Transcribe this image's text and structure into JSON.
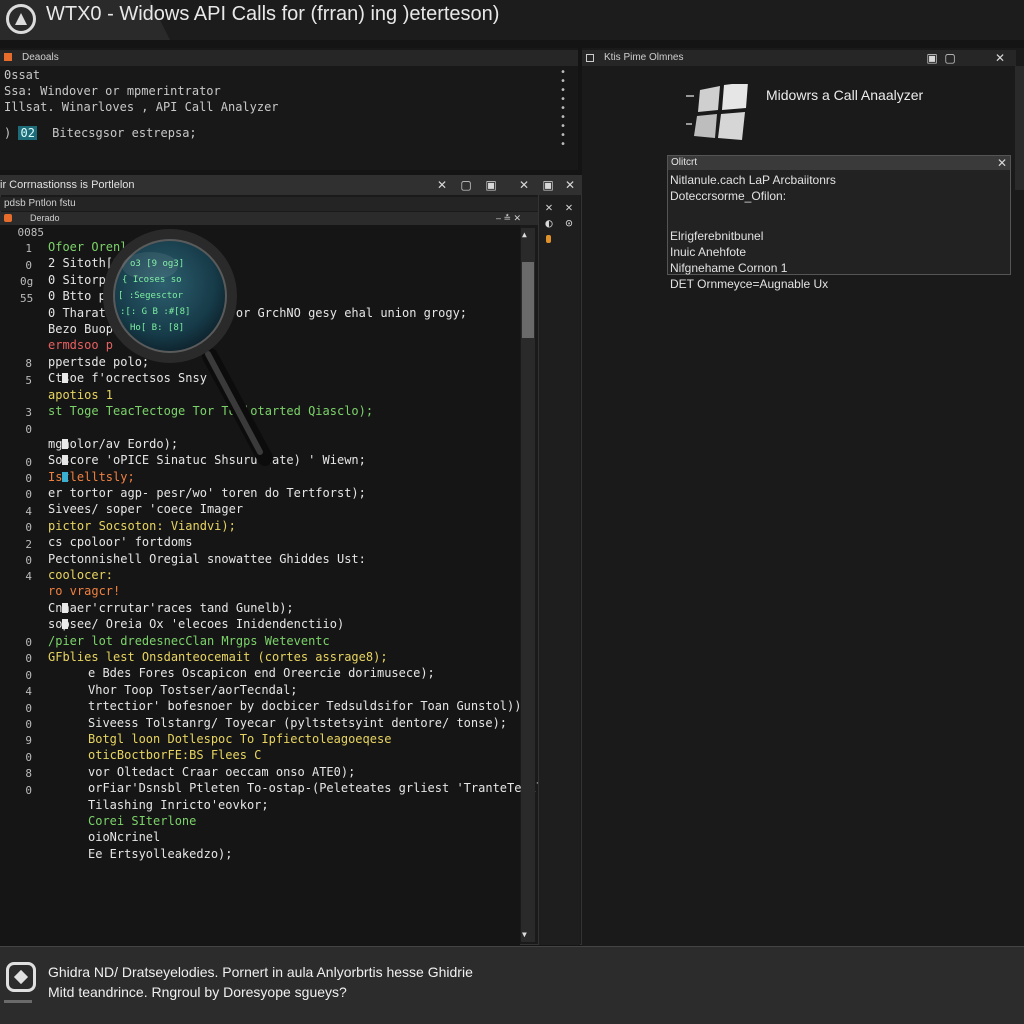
{
  "window": {
    "title": "WTX0 - Widows API Calls for (frran) ing )eterteson)"
  },
  "top_left": {
    "header": "Deaoals",
    "lines": [
      "0ssat",
      " Ssa: Windover  or  mpmerintrator",
      "Illsat. Winarloves , API Call Analyzer"
    ],
    "prompt_badge": "02",
    "prompt_prefix": ")",
    "prompt_text": "Bitecsgsor  estrepsa;",
    "dots": [
      "•",
      "•",
      "•",
      "•",
      "•",
      "•",
      "•",
      "•",
      "•"
    ]
  },
  "center": {
    "title": "ir Corrnastionss is Portlelon",
    "subheader": "pdsb Pntlon fstu",
    "listing_header": "Derado",
    "buttons": {
      "min": "✕",
      "restore": "▢",
      "max": "▣",
      "close": "✕",
      "pin": "▣",
      "close2": "✕"
    },
    "line_numbers": [
      "0085",
      "1",
      "0",
      "0g",
      "55",
      "",
      "",
      "",
      "8",
      "5",
      "",
      "3",
      "0",
      "",
      "0",
      "0",
      "0",
      "4",
      "0",
      "2",
      "0",
      "4",
      "",
      "",
      "",
      "0",
      "0",
      "0",
      "4",
      "0",
      "0",
      "9",
      "0",
      "8",
      "0"
    ],
    "code_lines": [
      {
        "text": "Ofoer Orenl",
        "color": "green"
      },
      {
        "text": "2  Sitoth[9og3",
        "color": "white"
      },
      {
        "text": "0  Sitorp p1",
        "color": "white"
      },
      {
        "text": "0  Btto p",
        "color": "white"
      },
      {
        "text": "0  Tharatr  mifocr Grefinto  or GrchNO gesy ehal union  grogy;",
        "color": "white"
      },
      {
        "text": "   Bezo Buop",
        "color": "white"
      },
      {
        "text": "     ermdsoo p",
        "color": "red"
      },
      {
        "text": "      ppertsde polo;",
        "color": "white"
      },
      {
        "text": "Ctsoe f'ocrectsos Snsy",
        "color": "white"
      },
      {
        "text": "apotios 1",
        "color": "yellow"
      },
      {
        "text": "  st  Toge TeacTectoge    Tor Toplotarted Qiasclo);",
        "color": "green"
      },
      {
        "text": "",
        "color": "white"
      },
      {
        "text": "  mgnolor/av Eordo);",
        "color": "white"
      },
      {
        "text": "Soscore 'oPICE  Sinatuc Shsurulcate) ' Wiewn;",
        "color": "white"
      },
      {
        "text": "  Istlelltsly;",
        "color": "orange"
      },
      {
        "text": "  er tortor agp- pesr/wo' toren do Tertforst);",
        "color": "white"
      },
      {
        "text": "    Sivees/ soper 'coece Imager",
        "color": "white"
      },
      {
        "text": "      pictor Socsoton: Viandvi);",
        "color": "yellow"
      },
      {
        "text": "  cs cpoloor' fortdoms",
        "color": "white"
      },
      {
        "text": "     Pectonnishell Oregial snowattee  Ghiddes Ust:",
        "color": "white"
      },
      {
        "text": "  coolocer:",
        "color": "yellow"
      },
      {
        "text": "  ro vragcr!",
        "color": "orange"
      },
      {
        "text": "Cnnaer'crrutar'races tand Gunelb);",
        "color": "white"
      },
      {
        "text": "sopsee/ Oreia Ox 'elecoes  Inidendenctiio)",
        "color": "white"
      },
      {
        "text": "   /pier lot dredesnecClan  Mrgps  Weteventc",
        "color": "green"
      },
      {
        "text": "     GFblies lest Onsdanteocemait (cortes assrage8);",
        "color": "yellow"
      },
      {
        "text": "   e Bdes Fores Oscapicon  end  Oreercie dorimusece);",
        "color": "white"
      },
      {
        "text": "Vhor Toop Tostser/aorTecndal;",
        "color": "white"
      },
      {
        "text": "trtectior' bofesnoer by docbicer Tedsuldsifor Toan Gunstol)),",
        "color": "white"
      },
      {
        "text": "   Siveess Tolstanrg/ Toyecar (pyltstetsyint dentore/ tonse);",
        "color": "white"
      },
      {
        "text": "      Botgl loon Dotlespoc To Ipfiectoleagoeqese",
        "color": "yellow"
      },
      {
        "text": "oticBoctborFE:BS Flees C",
        "color": "yellow"
      },
      {
        "text": "vor Oltedact Craar oeccam onso ATE0);",
        "color": "white"
      },
      {
        "text": "orFiar'Dsnsbl Ptleten To-ostap-(Peleteates grliest 'TranteTecilo;",
        "color": "white"
      },
      {
        "text": "Tilashing Inricto'eovkor;",
        "color": "white"
      },
      {
        "text": "Corei SIterlone",
        "color": "green"
      },
      {
        "text": "oioNcrinel",
        "color": "white"
      },
      {
        "text": "Ee Ertsyolleakedzo);",
        "color": "white"
      }
    ]
  },
  "right": {
    "header": "Ktis Pime Olmnes",
    "analyzer_title": "Midowrs a Call Anaalyzer",
    "dialog": {
      "title": "Olitcrt",
      "close": "✕",
      "lines": [
        "Nitlanule.cach LaP Arcbaiitonrs",
        "Doteccrsorme_Ofilon:",
        "",
        "Elrigferebnitbunel",
        "Inuic Anehfote",
        "Nifgnehame Cornon 1",
        "DET Ornmeyce=Augnable Ux"
      ]
    }
  },
  "footer": {
    "line1": "Ghidra ND/ Dratseyelodies. Pornert in aula Anlyorbrtis hesse Ghidrie",
    "line2": "Mitd teandrince. Rngroul by Doresyope sgueys?"
  }
}
